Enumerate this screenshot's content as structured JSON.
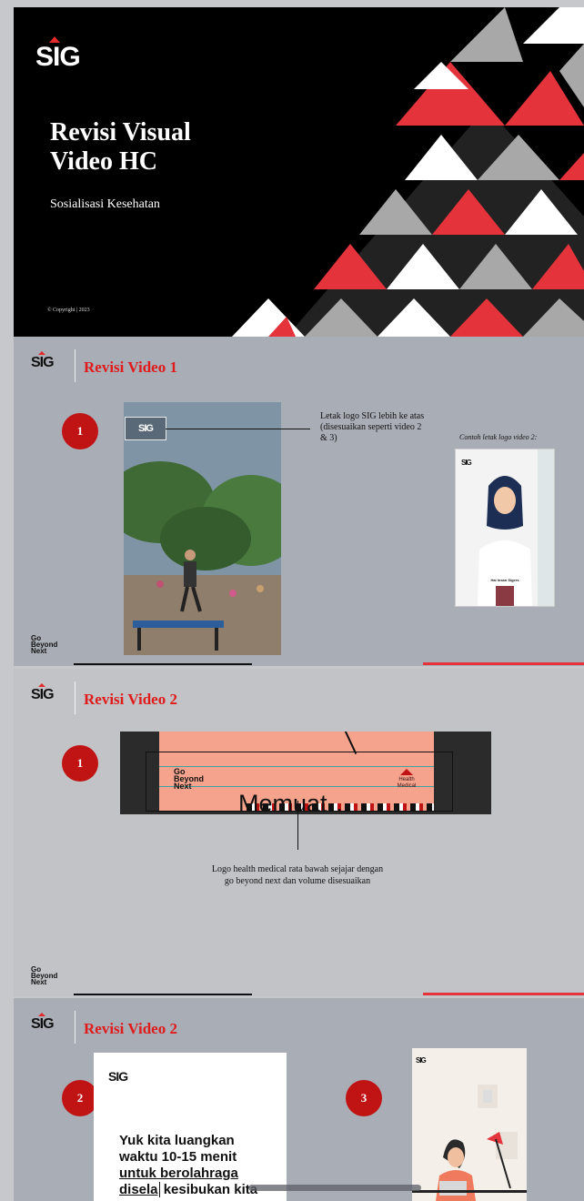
{
  "slide1": {
    "logo": "SIG",
    "title_line1": "Revisi Visual",
    "title_line2": "Video HC",
    "subtitle": "Sosialisasi Kesehatan",
    "copyright": "© Copyright | 2023"
  },
  "slide2": {
    "logo": "SIG",
    "title": "Revisi Video 1",
    "badge": "1",
    "phone_logo": "SIG",
    "annotation": "Letak logo SIG lebih ke atas (disesuaikan seperti video 2 & 3)",
    "example_caption": "Contoh letak logo video 2:",
    "example_logo": "SIG",
    "example_name": "Hai Insan Sigers",
    "footer_line1": "Go",
    "footer_line2": "Beyond",
    "footer_line3": "Next"
  },
  "slide3": {
    "logo": "SIG",
    "title": "Revisi Video 2",
    "badge": "1",
    "banner_line1": "Go",
    "banner_line2": "Beyond",
    "banner_line3": "Next",
    "banner_health1": "Health",
    "banner_health2": "Medical",
    "loading_text": "Memuat…",
    "annotation": "Logo health medical rata bawah sejajar dengan go beyond next dan volume disesuaikan",
    "footer_line1": "Go",
    "footer_line2": "Beyond",
    "footer_line3": "Next"
  },
  "slide4": {
    "logo": "SIG",
    "title": "Revisi Video 2",
    "badge2": "2",
    "badge3": "3",
    "card_logo": "SIG",
    "card_text_l1": "Yuk kita luangkan",
    "card_text_l2": "waktu 10-15 menit",
    "card_text_l3": "untuk berolahraga",
    "card_text_l4a": "disela",
    "card_text_l4b": " kesibukan kita",
    "card3_logo": "SIG"
  },
  "colors": {
    "accent_red": "#e01b1b",
    "badge_red": "#c01313",
    "slide_bg": "#a9adb6",
    "cover_bg": "#000000"
  }
}
